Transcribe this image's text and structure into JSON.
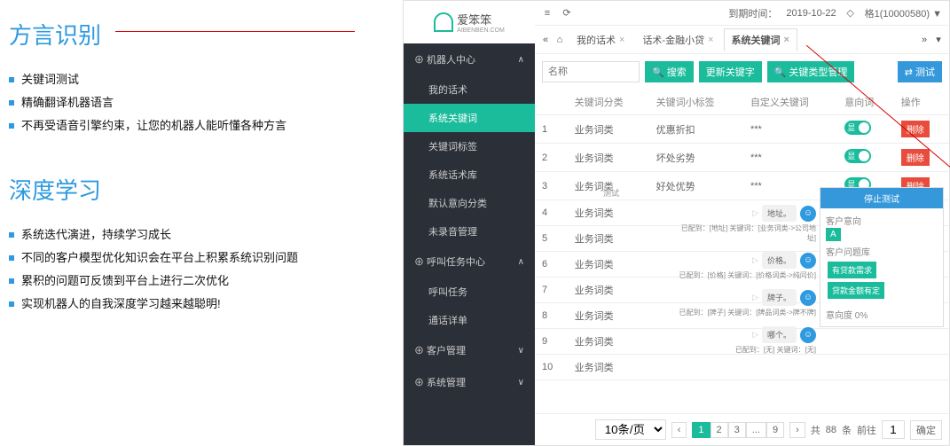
{
  "marketing": {
    "section1": {
      "title": "方言识别",
      "items": [
        "关键词测试",
        "精确翻译机器语言",
        "不再受语音引擎约束，让您的机器人能听懂各种方言"
      ]
    },
    "section2": {
      "title": "深度学习",
      "items": [
        "系统迭代演进，持续学习成长",
        "不同的客户模型优化知识会在平台上积累系统识别问题",
        "累积的问题可反馈到平台上进行二次优化",
        "实现机器人的自我深度学习越来越聪明!"
      ]
    }
  },
  "logo": {
    "brand": "爱笨笨",
    "sub": "AIBENBEN.COM"
  },
  "sidebar": {
    "groups": [
      {
        "name": "机器人中心",
        "open": true,
        "items": [
          "我的话术",
          "系统关键词",
          "关键词标签",
          "系统话术库",
          "默认意向分类",
          "未录音管理"
        ]
      },
      {
        "name": "呼叫任务中心",
        "open": true,
        "items": [
          "呼叫任务",
          "通话详单"
        ]
      },
      {
        "name": "客户管理",
        "open": false,
        "items": []
      },
      {
        "name": "系统管理",
        "open": false,
        "items": []
      }
    ],
    "active": "系统关键词"
  },
  "topbar": {
    "expire_label": "到期时间：",
    "expire": "2019-10-22",
    "user": "格1(10000580) ▼"
  },
  "tabs": {
    "home_icon": "⌂",
    "list": [
      "我的话术",
      "话术-金融小贷",
      "系统关键词"
    ],
    "active": "系统关键词",
    "close": "×"
  },
  "toolbar": {
    "name_ph": "名称",
    "search": "搜索",
    "update": "更新关键字",
    "manage": "关键类型管理",
    "test": "测试"
  },
  "table": {
    "headers": [
      "",
      "关键词分类",
      "关键词小标签",
      "自定义关键词",
      "意向词",
      "操作"
    ],
    "toggle_label": "显",
    "delete_label": "删除",
    "rows": [
      {
        "n": "1",
        "cat": "业务词类",
        "tag": "优惠折扣",
        "kw": "***",
        "toggle": true,
        "del": true
      },
      {
        "n": "2",
        "cat": "业务词类",
        "tag": "坏处劣势",
        "kw": "***",
        "toggle": true,
        "del": true
      },
      {
        "n": "3",
        "cat": "业务词类",
        "tag": "好处优势",
        "kw": "***",
        "toggle": true,
        "del": true
      },
      {
        "n": "4",
        "cat": "业务词类",
        "tag": "",
        "kw": "",
        "toggle": false,
        "del": false
      },
      {
        "n": "5",
        "cat": "业务词类",
        "tag": "",
        "kw": "",
        "toggle": false,
        "del": false
      },
      {
        "n": "6",
        "cat": "业务词类",
        "tag": "",
        "kw": "",
        "toggle": false,
        "del": false
      },
      {
        "n": "7",
        "cat": "业务词类",
        "tag": "",
        "kw": "",
        "toggle": false,
        "del": false
      },
      {
        "n": "8",
        "cat": "业务词类",
        "tag": "",
        "kw": "",
        "toggle": false,
        "del": false
      },
      {
        "n": "9",
        "cat": "业务词类",
        "tag": "",
        "kw": "",
        "toggle": false,
        "del": false
      },
      {
        "n": "10",
        "cat": "业务词类",
        "tag": "",
        "kw": "",
        "toggle": false,
        "del": false
      }
    ]
  },
  "bubbles": [
    {
      "text": "地址。",
      "match": "已配到：[地址] 关键词：[业务词类->公司地址]"
    },
    {
      "text": "价格。",
      "match": "已配到：[价格] 关键词：[价格词类->纯问价]"
    },
    {
      "text": "牌子。",
      "match": "已配到：[牌子] 关键词：[牌品词类->牌不牌]"
    },
    {
      "text": "哪个。",
      "match": "已配到：[无] 关键词：[无]"
    }
  ],
  "test_label": "测试",
  "overlay": {
    "title": "停止测试",
    "section1": "客户意向",
    "badge": "A",
    "section2": "客户问题库",
    "btn1": "有贷款需求",
    "btn2": "贷款金额有定",
    "result": "意向度 0%"
  },
  "pagination": {
    "per_page": "10条/页",
    "total_prefix": "共",
    "total": "88",
    "total_suffix": "条",
    "pages": [
      "1",
      "2",
      "3",
      "...",
      "9"
    ],
    "goto": "前往",
    "page_input": "1",
    "confirm": "确定"
  }
}
